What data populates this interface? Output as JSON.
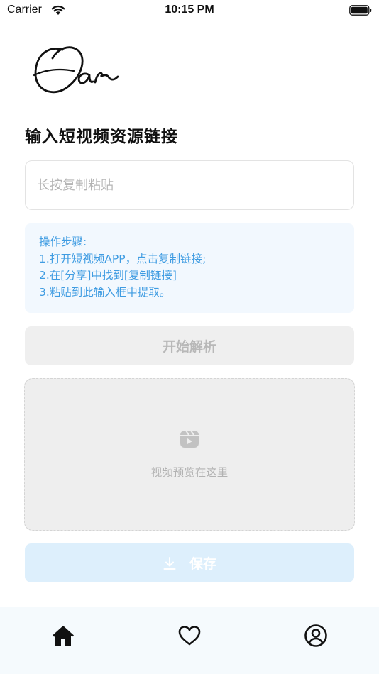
{
  "status_bar": {
    "carrier": "Carrier",
    "time": "10:15 PM"
  },
  "logo": {
    "text": "Oar"
  },
  "main": {
    "title": "输入短视频资源链接",
    "link_input": {
      "value": "",
      "placeholder": "长按复制粘贴"
    },
    "steps": {
      "heading": "操作步骤:",
      "items": [
        "1.打开短视频APP，点击复制链接;",
        "2.在[分享]中找到[复制链接]",
        "3.粘贴到此输入框中提取。"
      ]
    },
    "parse_button": {
      "label": "开始解析"
    },
    "preview": {
      "icon": "video-clip-icon",
      "text": "视频预览在这里"
    },
    "save_button": {
      "icon": "download-icon",
      "label": "保存"
    }
  },
  "tab_bar": {
    "items": [
      {
        "icon": "home-icon",
        "active": true
      },
      {
        "icon": "heart-icon",
        "active": false
      },
      {
        "icon": "user-circle-icon",
        "active": false
      }
    ]
  },
  "colors": {
    "accent": "#3f9ce2",
    "steps_bg": "#f2f8fe",
    "save_bg": "#ddeffc",
    "disabled_bg": "#efefef",
    "tab_bar_bg": "#f5fafd"
  }
}
